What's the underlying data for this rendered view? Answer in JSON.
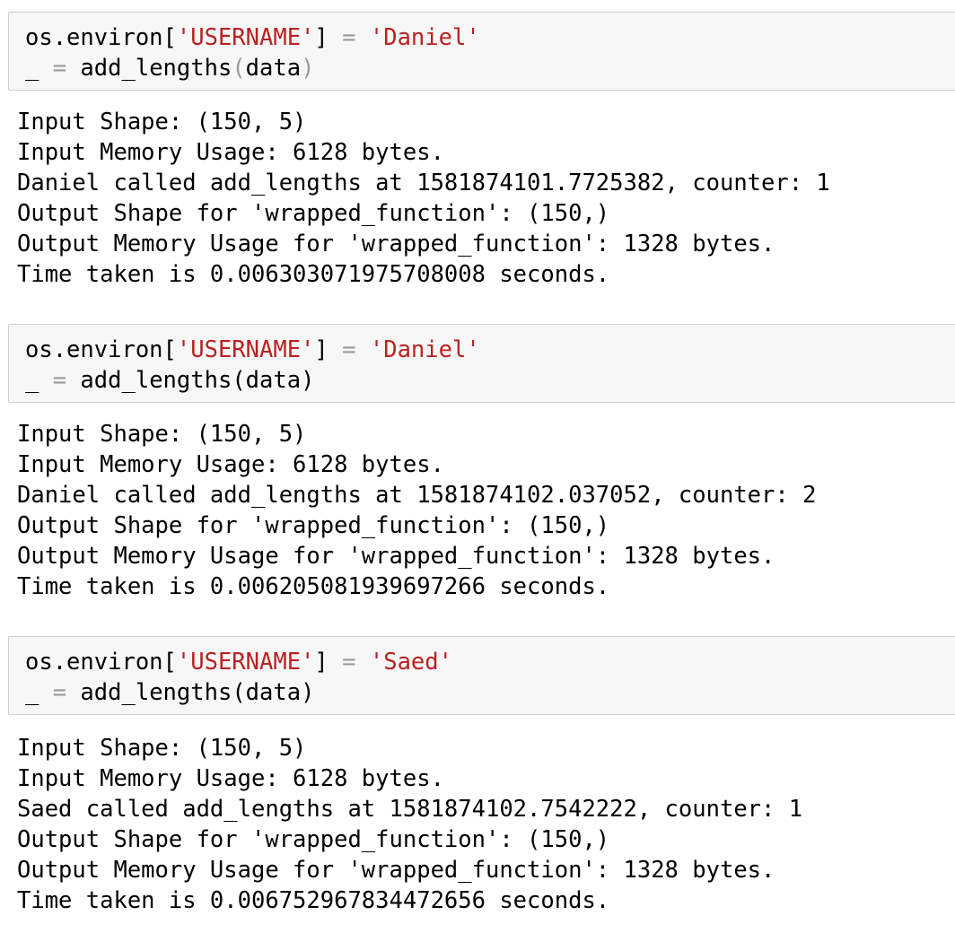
{
  "cells": [
    {
      "code": {
        "line1": {
          "prefix": "os.environ[",
          "key": "'USERNAME'",
          "mid": "] ",
          "eq": "=",
          "sp": " ",
          "value": "'Daniel'"
        },
        "line2": {
          "lhs": "_ ",
          "eq": "=",
          "call": " add_lengths",
          "open": "(",
          "arg": "data",
          "close": ")"
        }
      },
      "output": [
        "Input Shape: (150, 5)",
        "Input Memory Usage: 6128 bytes.",
        "Daniel called add_lengths at 1581874101.7725382, counter: 1",
        "Output Shape for 'wrapped_function': (150,)",
        "Output Memory Usage for 'wrapped_function': 1328 bytes.",
        "Time taken is 0.006303071975708008 seconds."
      ]
    },
    {
      "code": {
        "line1": {
          "prefix": "os.environ[",
          "key": "'USERNAME'",
          "mid": "] ",
          "eq": "=",
          "sp": " ",
          "value": "'Daniel'"
        },
        "line2": {
          "lhs": "_ ",
          "eq": "=",
          "call": " add_lengths",
          "open": "(",
          "arg": "data",
          "close": ")"
        }
      },
      "output": [
        "Input Shape: (150, 5)",
        "Input Memory Usage: 6128 bytes.",
        "Daniel called add_lengths at 1581874102.037052, counter: 2",
        "Output Shape for 'wrapped_function': (150,)",
        "Output Memory Usage for 'wrapped_function': 1328 bytes.",
        "Time taken is 0.006205081939697266 seconds."
      ]
    },
    {
      "code": {
        "line1": {
          "prefix": "os.environ[",
          "key": "'USERNAME'",
          "mid": "] ",
          "eq": "=",
          "sp": " ",
          "value": "'Saed'"
        },
        "line2": {
          "lhs": "_ ",
          "eq": "=",
          "call": " add_lengths",
          "open": "(",
          "arg": "data",
          "close": ")"
        }
      },
      "output": [
        "Input Shape: (150, 5)",
        "Input Memory Usage: 6128 bytes.",
        "Saed called add_lengths at 1581874102.7542222, counter: 1",
        "Output Shape for 'wrapped_function': (150,)",
        "Output Memory Usage for 'wrapped_function': 1328 bytes.",
        "Time taken is 0.006752967834472656 seconds."
      ]
    }
  ]
}
